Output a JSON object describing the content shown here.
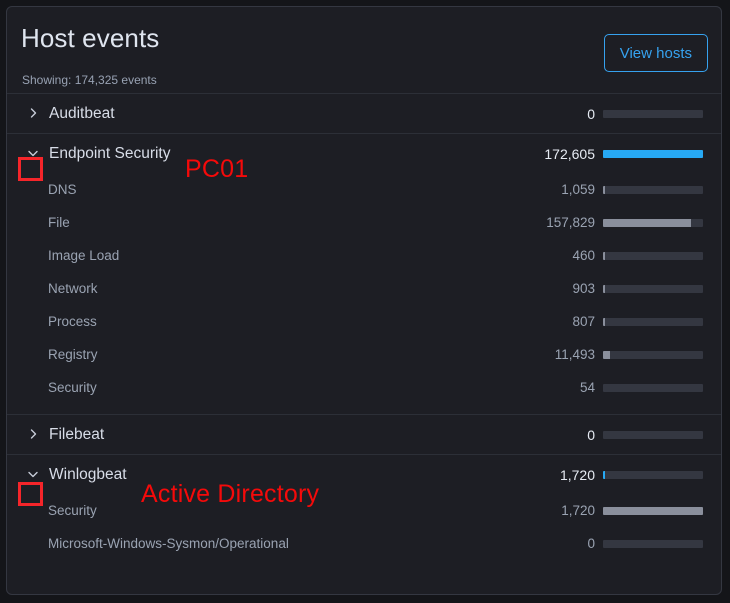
{
  "header": {
    "title": "Host events",
    "showing": "Showing: 174,325 events",
    "view_hosts_label": "View hosts",
    "accent_color": "#36a2ef"
  },
  "colors": {
    "panel_bg": "#1d1e24",
    "panel_border": "#343741",
    "bar_track": "#343741",
    "bar_fill": "#8a8f9c",
    "bar_fill_accent": "#27a9f4",
    "annotation_red": "#f5252a"
  },
  "icons": {
    "chevron_right": "chevron-right-icon",
    "chevron_down": "chevron-down-icon"
  },
  "groups": [
    {
      "label": "Auditbeat",
      "value": "0",
      "expanded": false,
      "bar_pct": 0,
      "bar_accent": false,
      "children": []
    },
    {
      "label": "Endpoint Security",
      "value": "172,605",
      "expanded": true,
      "bar_pct": 100,
      "bar_accent": true,
      "annotation": "PC01",
      "children": [
        {
          "label": "DNS",
          "value": "1,059",
          "bar_pct": 1
        },
        {
          "label": "File",
          "value": "157,829",
          "bar_pct": 88
        },
        {
          "label": "Image Load",
          "value": "460",
          "bar_pct": 1
        },
        {
          "label": "Network",
          "value": "903",
          "bar_pct": 1
        },
        {
          "label": "Process",
          "value": "807",
          "bar_pct": 1
        },
        {
          "label": "Registry",
          "value": "11,493",
          "bar_pct": 7
        },
        {
          "label": "Security",
          "value": "54",
          "bar_pct": 0
        }
      ]
    },
    {
      "label": "Filebeat",
      "value": "0",
      "expanded": false,
      "bar_pct": 0,
      "bar_accent": false,
      "children": []
    },
    {
      "label": "Winlogbeat",
      "value": "1,720",
      "expanded": true,
      "bar_pct": 1,
      "bar_accent": true,
      "annotation": "Active Directory",
      "children": [
        {
          "label": "Security",
          "value": "1,720",
          "bar_pct": 100
        },
        {
          "label": "Microsoft-Windows-Sysmon/Operational",
          "value": "0",
          "bar_pct": 0
        }
      ]
    }
  ],
  "chart_data": {
    "type": "bar",
    "title": "Host events",
    "xlabel": "",
    "ylabel": "",
    "categories": [
      "Auditbeat",
      "Endpoint Security",
      "Endpoint Security / DNS",
      "Endpoint Security / File",
      "Endpoint Security / Image Load",
      "Endpoint Security / Network",
      "Endpoint Security / Process",
      "Endpoint Security / Registry",
      "Endpoint Security / Security",
      "Filebeat",
      "Winlogbeat",
      "Winlogbeat / Security",
      "Winlogbeat / Microsoft-Windows-Sysmon/Operational"
    ],
    "values": [
      0,
      172605,
      1059,
      157829,
      460,
      903,
      807,
      11493,
      54,
      0,
      1720,
      1720,
      0
    ],
    "total": 174325,
    "legend": [],
    "grid": false
  }
}
